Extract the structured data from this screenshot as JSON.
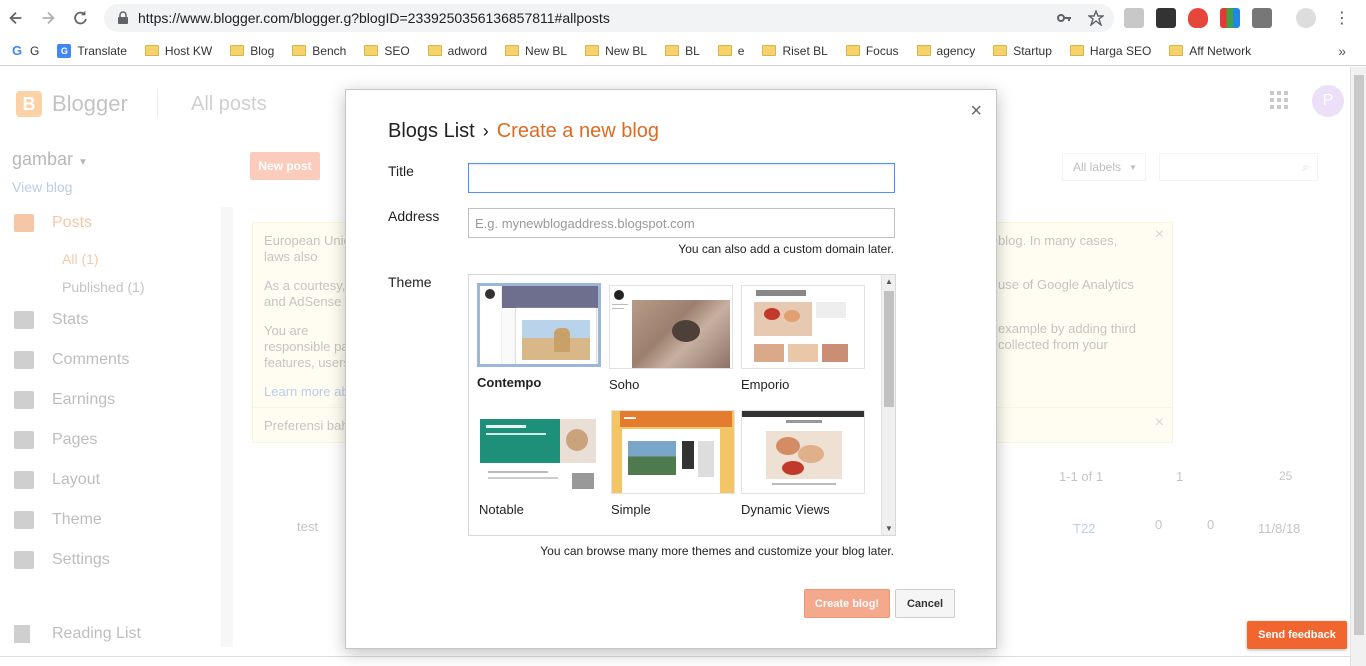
{
  "browser": {
    "url": "https://www.blogger.com/blogger.g?blogID=2339250356136857811#allposts",
    "bookmarks": [
      {
        "label": "G",
        "type": "google"
      },
      {
        "label": "Translate",
        "type": "translate"
      },
      {
        "label": "Host KW",
        "type": "folder"
      },
      {
        "label": "Blog",
        "type": "folder"
      },
      {
        "label": "Bench",
        "type": "folder"
      },
      {
        "label": "SEO",
        "type": "folder"
      },
      {
        "label": "adword",
        "type": "folder"
      },
      {
        "label": "New BL",
        "type": "folder"
      },
      {
        "label": "New BL",
        "type": "folder"
      },
      {
        "label": "BL",
        "type": "folder"
      },
      {
        "label": "e",
        "type": "folder"
      },
      {
        "label": "Riset BL",
        "type": "folder"
      },
      {
        "label": "Focus",
        "type": "folder"
      },
      {
        "label": "agency",
        "type": "folder"
      },
      {
        "label": "Startup",
        "type": "folder"
      },
      {
        "label": "Harga SEO",
        "type": "folder"
      },
      {
        "label": "Aff Network",
        "type": "folder"
      }
    ],
    "more_label": "»"
  },
  "blogger": {
    "app_name": "Blogger",
    "section": "All posts",
    "avatar_letter": "P",
    "blog_name": "gambar",
    "view_blog": "View blog",
    "nav": {
      "posts": "Posts",
      "all": "All (1)",
      "published": "Published (1)",
      "stats": "Stats",
      "comments": "Comments",
      "earnings": "Earnings",
      "pages": "Pages",
      "layout": "Layout",
      "theme": "Theme",
      "settings": "Settings",
      "reading_list": "Reading List"
    },
    "new_post": "New post",
    "all_labels": "All labels",
    "notice": {
      "p1": "European Union laws also",
      "p1_right": "blog. In many cases,",
      "p2": "As a courtesy, and AdSense",
      "p2_right": "use of Google Analytics",
      "p3": "You are responsible party features, users.",
      "p3_right": "example by adding third collected from your",
      "learn_more": "Learn more ab",
      "pref": "Preferensi bah"
    },
    "pager": "1-1 of 1",
    "page_num": "1",
    "per_page": "25",
    "post": {
      "title": "test",
      "label": "T22",
      "comments": "0",
      "views": "0",
      "date": "11/8/18"
    }
  },
  "modal": {
    "breadcrumb_root": "Blogs List",
    "breadcrumb_sep": "›",
    "breadcrumb_current": "Create a new blog",
    "title_label": "Title",
    "title_value": "",
    "address_label": "Address",
    "address_placeholder": "E.g. mynewblogaddress.blogspot.com",
    "address_hint": "You can also add a custom domain later.",
    "theme_label": "Theme",
    "themes": [
      {
        "name": "Contempo",
        "selected": true
      },
      {
        "name": "Soho",
        "selected": false
      },
      {
        "name": "Emporio",
        "selected": false
      },
      {
        "name": "Notable",
        "selected": false
      },
      {
        "name": "Simple",
        "selected": false
      },
      {
        "name": "Dynamic Views",
        "selected": false
      }
    ],
    "theme_hint": "You can browse many more themes and customize your blog later.",
    "create_button": "Create blog!",
    "cancel_button": "Cancel",
    "close_icon": "×"
  },
  "feedback_button": "Send feedback",
  "colors": {
    "accent": "#dd6b20",
    "primary_button": "#f4a88c",
    "feedback": "#f0662e"
  }
}
